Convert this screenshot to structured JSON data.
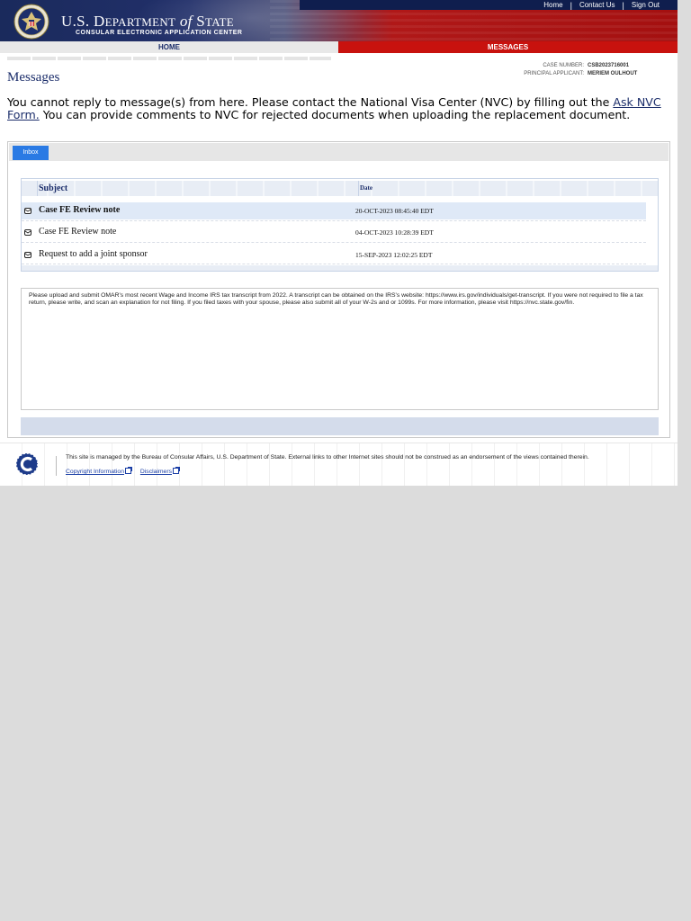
{
  "header": {
    "top_links": [
      "Home",
      "Contact Us",
      "Sign Out"
    ],
    "dept_title_part1": "U.S. D",
    "dept_title_part2": "EPARTMENT",
    "dept_title_of": "of",
    "dept_title_part3": "S",
    "dept_title_part4": "TATE",
    "dept_subtitle": "CONSULAR ELECTRONIC APPLICATION CENTER"
  },
  "nav": {
    "home": "HOME",
    "messages": "MESSAGES"
  },
  "page_title": "Messages",
  "case_info": {
    "case_number_label": "CASE NUMBER:",
    "case_number": "CSB2023716001",
    "principal_label": "PRINCIPAL APPLICANT:",
    "principal_name": "MERIEM OULHOUT"
  },
  "notice": {
    "text1": "You cannot reply to message(s) from here.  Please contact the National Visa Center (NVC) by filling out the ",
    "link": "Ask NVC Form.",
    "text2": "  You can provide comments to NVC for rejected documents when uploading the replacement document."
  },
  "inbox_tab": "Inbox",
  "table": {
    "col_subject": "Subject",
    "col_date": "Date",
    "rows": [
      {
        "subject": "Case FE Review note",
        "date": "20-OCT-2023 08:45:40 EDT"
      },
      {
        "subject": "Case FE Review note",
        "date": "04-OCT-2023 10:28:39 EDT"
      },
      {
        "subject": "Request to add a joint sponsor",
        "date": "15-SEP-2023 12:02:25 EDT"
      }
    ]
  },
  "message_body": "Please upload and submit OMAR's most recent Wage and Income IRS tax transcript from 2022. A transcript can be obtained on the IRS's website: https://www.irs.gov/individuals/get-transcript. If you were not required to file a tax return, please write, and scan an explanation for not filing. If you filed taxes with your spouse, please also submit all of your W-2s and or 1099s. For more information, please visit https://nvc.state.gov/fin.",
  "footer": {
    "text": "This site is managed by the Bureau of Consular Affairs, U.S. Department of State. External links to other Internet sites should not be construed as an endorsement of the views contained therein.",
    "copyright": "Copyright Information",
    "disclaimers": "Disclaimers"
  },
  "colors": {
    "navy": "#1b2d6a",
    "red": "#c8120e",
    "tab_blue": "#2a7ae4",
    "selected_row": "#dfe9f7"
  }
}
